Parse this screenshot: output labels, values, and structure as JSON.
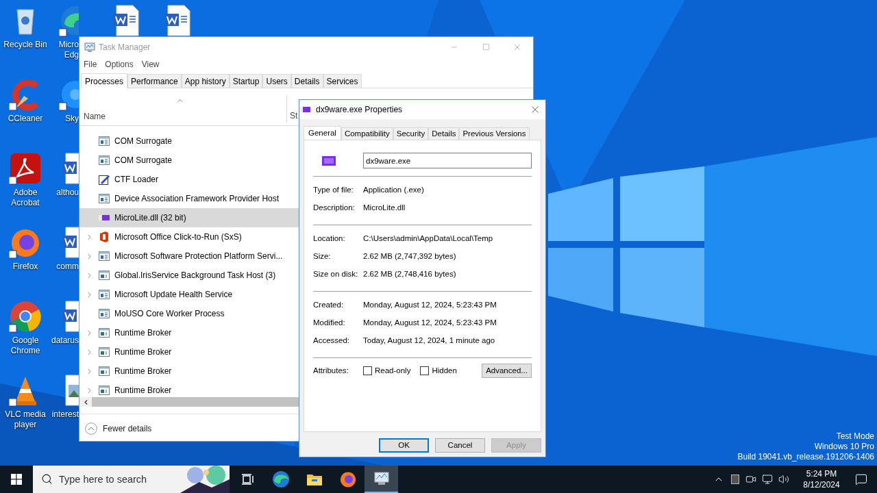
{
  "desktop": {
    "columns": [
      [
        {
          "kind": "recycle",
          "label_lines": [
            "Recycle Bin"
          ]
        },
        {
          "kind": "ccleaner",
          "label_lines": [
            "CCleaner"
          ]
        },
        {
          "kind": "acrobat",
          "label_lines": [
            "Adobe",
            "Acrobat"
          ]
        },
        {
          "kind": "firefox",
          "label_lines": [
            "Firefox"
          ]
        },
        {
          "kind": "chrome",
          "label_lines": [
            "Google",
            "Chrome"
          ]
        },
        {
          "kind": "vlc",
          "label_lines": [
            "VLC media",
            "player"
          ]
        }
      ],
      [
        {
          "kind": "edge",
          "label_lines": [
            "Micro",
            "Edg"
          ]
        },
        {
          "kind": "skype",
          "label_lines": [
            "Sky"
          ]
        },
        {
          "kind": "word",
          "label_lines": [
            "althou"
          ]
        },
        {
          "kind": "word",
          "label_lines": [
            "comm"
          ]
        },
        {
          "kind": "word",
          "label_lines": [
            "datarus"
          ]
        },
        {
          "label_lines": [
            "interest"
          ]
        }
      ]
    ],
    "top_row": [
      {
        "kind": "word"
      },
      {
        "kind": "word"
      }
    ],
    "system_text": [
      "Test Mode",
      "Windows 10 Pro",
      "Build 19041.vb_release.191206-1406"
    ]
  },
  "task_manager": {
    "title": "Task Manager",
    "menu": [
      "File",
      "Options",
      "View"
    ],
    "tabs": [
      {
        "label": "Processes",
        "selected": true
      },
      {
        "label": "Performance",
        "selected": false
      },
      {
        "label": "App history",
        "selected": false
      },
      {
        "label": "Startup",
        "selected": false
      },
      {
        "label": "Users",
        "selected": false
      },
      {
        "label": "Details",
        "selected": false
      },
      {
        "label": "Services",
        "selected": false
      }
    ],
    "columns": [
      "Name",
      "St"
    ],
    "processes": [
      {
        "name": "COM Surrogate",
        "kind": "window",
        "expandable": false,
        "selected": false
      },
      {
        "name": "COM Surrogate",
        "kind": "window",
        "expandable": false,
        "selected": false
      },
      {
        "name": "CTF Loader",
        "kind": "pen",
        "expandable": false,
        "selected": false
      },
      {
        "name": "Device Association Framework Provider Host",
        "kind": "window",
        "expandable": false,
        "selected": false
      },
      {
        "name": "MicroLite.dll (32 bit)",
        "kind": "vare",
        "expandable": false,
        "selected": true
      },
      {
        "name": "Microsoft Office Click-to-Run (SxS)",
        "kind": "office",
        "expandable": true,
        "selected": false
      },
      {
        "name": "Microsoft Software Protection Platform Servi...",
        "kind": "window",
        "expandable": true,
        "selected": false
      },
      {
        "name": "Global.IrisService Background Task Host (3)",
        "kind": "app",
        "expandable": true,
        "selected": false
      },
      {
        "name": "Microsoft Update Health Service",
        "kind": "window",
        "expandable": true,
        "selected": false
      },
      {
        "name": "MoUSO Core Worker Process",
        "kind": "window",
        "expandable": false,
        "selected": false
      },
      {
        "name": "Runtime Broker",
        "kind": "app",
        "expandable": true,
        "selected": false
      },
      {
        "name": "Runtime Broker",
        "kind": "app",
        "expandable": true,
        "selected": false
      },
      {
        "name": "Runtime Broker",
        "kind": "app",
        "expandable": true,
        "selected": false
      },
      {
        "name": "Runtime Broker",
        "kind": "app",
        "expandable": true,
        "selected": false
      }
    ],
    "footer": "Fewer details"
  },
  "properties": {
    "title": "dx9ware.exe Properties",
    "tabs": [
      {
        "label": "General",
        "selected": true
      },
      {
        "label": "Compatibility",
        "selected": false
      },
      {
        "label": "Security",
        "selected": false
      },
      {
        "label": "Details",
        "selected": false
      },
      {
        "label": "Previous Versions",
        "selected": false
      }
    ],
    "file_name": "dx9ware.exe",
    "groups": [
      [
        {
          "label": "Type of file:",
          "value": "Application (.exe)"
        },
        {
          "label": "Description:",
          "value": "MicroLite.dll"
        }
      ],
      [
        {
          "label": "Location:",
          "value": "C:\\Users\\admin\\AppData\\Local\\Temp"
        },
        {
          "label": "Size:",
          "value": "2.62 MB (2,747,392 bytes)"
        },
        {
          "label": "Size on disk:",
          "value": "2.62 MB (2,748,416 bytes)"
        }
      ],
      [
        {
          "label": "Created:",
          "value": "Monday, August 12, 2024, 5:23:43 PM"
        },
        {
          "label": "Modified:",
          "value": "Monday, August 12, 2024, 5:23:43 PM"
        },
        {
          "label": "Accessed:",
          "value": "Today, August 12, 2024, 1 minute ago"
        }
      ]
    ],
    "attributes": {
      "label": "Attributes:",
      "checkboxes": [
        {
          "label": "Read-only",
          "checked": false
        },
        {
          "label": "Hidden",
          "checked": false
        }
      ],
      "button": "Advanced..."
    },
    "buttons": [
      {
        "label": "OK",
        "kind": "default"
      },
      {
        "label": "Cancel",
        "kind": "normal"
      },
      {
        "label": "Apply",
        "kind": "disabled"
      }
    ]
  },
  "taskbar": {
    "search": {
      "placeholder": "Type here to search"
    },
    "apps": [
      {
        "kind": "taskview",
        "active": false
      },
      {
        "kind": "edge",
        "active": false
      },
      {
        "kind": "explorer",
        "active": false
      },
      {
        "kind": "firefox",
        "active": false
      },
      {
        "kind": "taskmgr",
        "active": true
      }
    ],
    "clock": {
      "time": "5:24 PM",
      "date": "8/12/2024"
    }
  }
}
